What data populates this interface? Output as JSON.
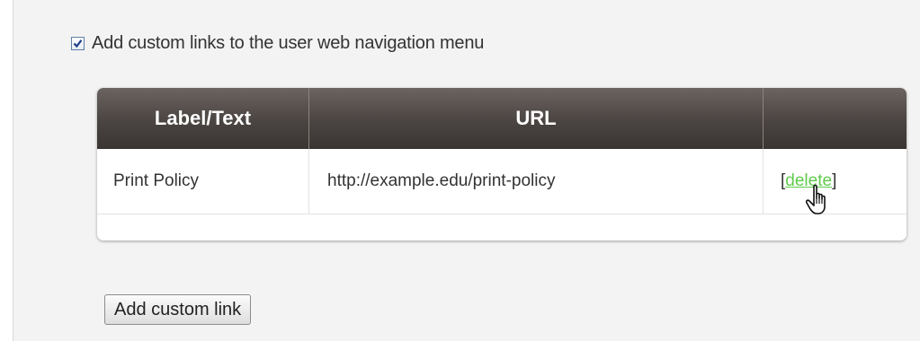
{
  "option": {
    "checkbox_checked": true,
    "label": "Add custom links to the user web navigation menu"
  },
  "table": {
    "headers": [
      "Label/Text",
      "URL",
      ""
    ],
    "rows": [
      {
        "label": "Print Policy",
        "url": "http://example.edu/print-policy",
        "action_open": "[",
        "action": "delete",
        "action_close": "]"
      }
    ]
  },
  "buttons": {
    "add_custom_link": "Add custom link"
  },
  "colors": {
    "header_bg": "#4a4442",
    "link_green": "#5fcb4c",
    "panel_bg": "#f3f3f3"
  },
  "icons": {
    "checkbox": "checkmark-icon",
    "cursor": "hand-pointer-icon"
  }
}
